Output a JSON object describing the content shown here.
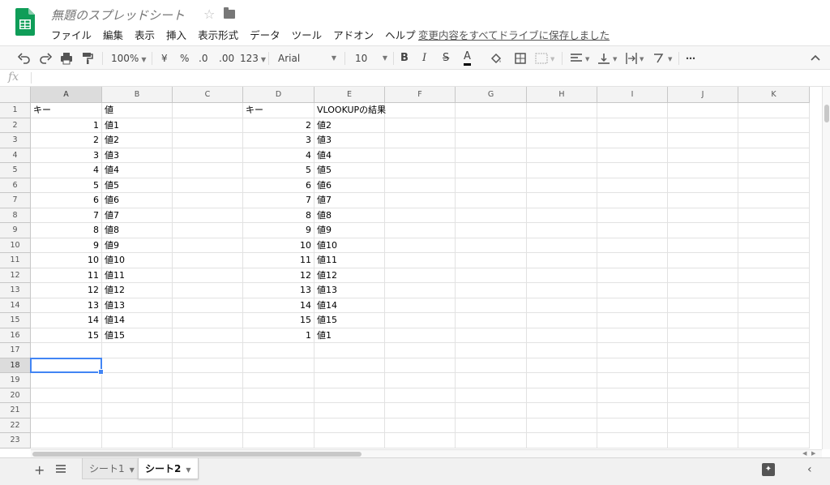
{
  "document": {
    "title": "無題のスプレッドシート",
    "save_status": "変更内容をすべてドライブに保存しました"
  },
  "menu": [
    "ファイル",
    "編集",
    "表示",
    "挿入",
    "表示形式",
    "データ",
    "ツール",
    "アドオン",
    "ヘルプ"
  ],
  "toolbar": {
    "zoom": "100%",
    "currency": "¥",
    "percent": "%",
    "decrease_decimal": ".0",
    "increase_decimal": ".00",
    "more_formats": "123",
    "font": "Arial",
    "font_size": "10",
    "more": "⋯"
  },
  "formula_bar": {
    "fx": "fx",
    "value": ""
  },
  "grid": {
    "columns": [
      "A",
      "B",
      "C",
      "D",
      "E",
      "F",
      "G",
      "H",
      "I",
      "J",
      "K"
    ],
    "rows": [
      "1",
      "2",
      "3",
      "4",
      "5",
      "6",
      "7",
      "8",
      "9",
      "10",
      "11",
      "12",
      "13",
      "14",
      "15",
      "16",
      "17",
      "18",
      "19",
      "20",
      "21",
      "22",
      "23"
    ],
    "selected_cell": "A18",
    "cells": {
      "A1": "キー",
      "B1": "値",
      "D1": "キー",
      "E1": "VLOOKUPの結果",
      "A2": "1",
      "B2": "値1",
      "D2": "2",
      "E2": "値2",
      "A3": "2",
      "B3": "値2",
      "D3": "3",
      "E3": "値3",
      "A4": "3",
      "B4": "値3",
      "D4": "4",
      "E4": "値4",
      "A5": "4",
      "B5": "値4",
      "D5": "5",
      "E5": "値5",
      "A6": "5",
      "B6": "値5",
      "D6": "6",
      "E6": "値6",
      "A7": "6",
      "B7": "値6",
      "D7": "7",
      "E7": "値7",
      "A8": "7",
      "B8": "値7",
      "D8": "8",
      "E8": "値8",
      "A9": "8",
      "B9": "値8",
      "D9": "9",
      "E9": "値9",
      "A10": "9",
      "B10": "値9",
      "D10": "10",
      "E10": "値10",
      "A11": "10",
      "B11": "値10",
      "D11": "11",
      "E11": "値11",
      "A12": "11",
      "B12": "値11",
      "D12": "12",
      "E12": "値12",
      "A13": "12",
      "B13": "値12",
      "D13": "13",
      "E13": "値13",
      "A14": "13",
      "B14": "値13",
      "D14": "14",
      "E14": "値14",
      "A15": "14",
      "B15": "値14",
      "D15": "15",
      "E15": "値15",
      "A16": "15",
      "B16": "値15",
      "D16": "1",
      "E16": "値1"
    }
  },
  "sheets": {
    "tabs": [
      "シート1",
      "シート2"
    ],
    "active": "シート2"
  },
  "colors": {
    "selection": "#4285f4",
    "logo_green": "#0f9d58"
  }
}
